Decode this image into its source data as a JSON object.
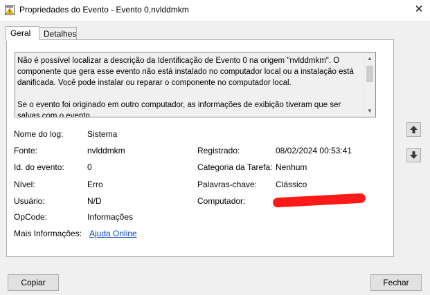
{
  "window": {
    "title": "Propriedades do Evento - Evento 0,nvlddmkm",
    "close_glyph": "✕"
  },
  "tabs": [
    {
      "label": "Geral",
      "active": true
    },
    {
      "label": "Detalhes",
      "active": false
    }
  ],
  "description": {
    "paragraph1": "Não é possível localizar a descrição da Identificação de Evento 0 na origem \"nvlddmkm\". O\ncomponente que gera esse evento não está instalado no computador local ou a instalação está\ndanificada. Você pode instalar ou reparar o componente no computador local.",
    "paragraph2": "Se o evento foi originado em outro computador, as informações de exibição tiveram que ser\nsalvas com o evento."
  },
  "fields": {
    "log_name": {
      "label": "Nome do log:",
      "value": "Sistema"
    },
    "source": {
      "label": "Fonte:",
      "value": "nvlddmkm"
    },
    "event_id": {
      "label": "Id. do evento:",
      "value": "0"
    },
    "level": {
      "label": "Nível:",
      "value": "Erro"
    },
    "user": {
      "label": "Usuário:",
      "value": "N/D"
    },
    "opcode": {
      "label": "OpCode:",
      "value": "Informações"
    },
    "more_info": {
      "label": "Mais Informações:",
      "value": "Ajuda Online"
    },
    "logged": {
      "label": "Registrado:",
      "value": "08/02/2024 00:53:41"
    },
    "task_category": {
      "label": "Categoria da Tarefa:",
      "value": "Nenhum"
    },
    "keywords": {
      "label": "Palavras-chave:",
      "value": "Clássico"
    },
    "computer": {
      "label": "Computador:",
      "value": ""
    }
  },
  "buttons": {
    "copy": "Copiar",
    "close": "Fechar"
  },
  "colors": {
    "link": "#0645ad",
    "redaction": "#ff1a1a"
  }
}
